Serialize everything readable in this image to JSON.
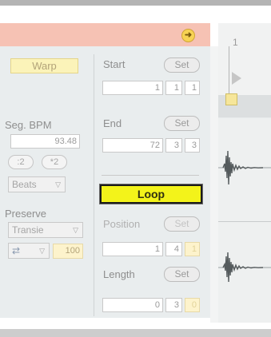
{
  "header": {
    "clip_icon_name": "arrow-right-icon",
    "clip_icon_glyph": "➜"
  },
  "clip": {
    "warp_label": "Warp",
    "seg_bpm_label": "Seg. BPM",
    "seg_bpm_value": "93.48",
    "halve_label": ":2",
    "double_label": "*2",
    "warp_mode": "Beats",
    "preserve_label": "Preserve",
    "preserve_value": "Transie",
    "loop_mode_value": "100"
  },
  "sample": {
    "start_label": "Start",
    "start_set": "Set",
    "start_values": [
      "1",
      "1",
      "1"
    ],
    "end_label": "End",
    "end_set": "Set",
    "end_values": [
      "72",
      "3",
      "3"
    ],
    "loop_label": "Loop",
    "position_label": "Position",
    "position_set": "Set",
    "position_values": [
      "1",
      "4",
      "1"
    ],
    "length_label": "Length",
    "length_set": "Set",
    "length_values": [
      "0",
      "3",
      "0"
    ]
  },
  "arrangement": {
    "ruler_label": "1"
  },
  "colors": {
    "clip_header": "#f6c2b4",
    "loop_active": "#f3f31a",
    "warp_bg": "#fbf3b9",
    "panel_bg": "#e9edee"
  }
}
